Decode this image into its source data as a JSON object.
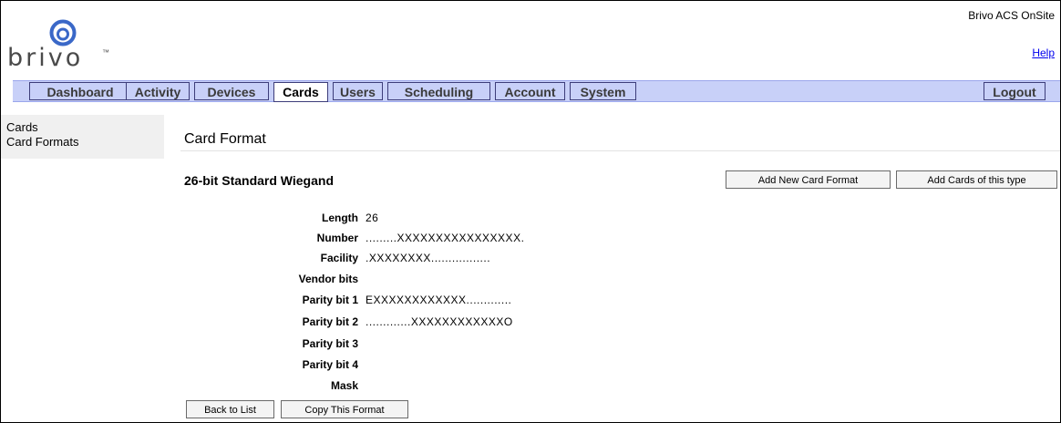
{
  "header": {
    "logo_text": "brivo",
    "logo_tm": "™",
    "app_title": "Brivo ACS OnSite",
    "help_link": "Help"
  },
  "nav": {
    "tabs": [
      {
        "label": "Dashboard"
      },
      {
        "label": "Activity"
      },
      {
        "label": "Devices"
      },
      {
        "label": "Cards",
        "active": true
      },
      {
        "label": "Users"
      },
      {
        "label": "Scheduling"
      },
      {
        "label": "Account"
      },
      {
        "label": "System"
      }
    ],
    "logout_label": "Logout"
  },
  "sidebar": {
    "items": [
      {
        "label": "Cards"
      },
      {
        "label": "Card Formats"
      }
    ]
  },
  "main": {
    "section_title": "Card Format",
    "format_name": "26-bit Standard Wiegand",
    "add_new_format_button": "Add New Card Format",
    "add_cards_button": "Add Cards of this type",
    "fields": [
      {
        "label": "Length",
        "value": "26"
      },
      {
        "label": "Number",
        "value": ".........XXXXXXXXXXXXXXXX."
      },
      {
        "label": "Facility",
        "value": ".XXXXXXXX................."
      },
      {
        "label": "Vendor bits",
        "value": ""
      },
      {
        "label": "Parity bit 1",
        "value": "EXXXXXXXXXXXX............."
      },
      {
        "label": "Parity bit 2",
        "value": ".............XXXXXXXXXXXXO"
      },
      {
        "label": "Parity bit 3",
        "value": ""
      },
      {
        "label": "Parity bit 4",
        "value": ""
      },
      {
        "label": "Mask",
        "value": ""
      }
    ],
    "back_button": "Back to List",
    "copy_button": "Copy This Format"
  },
  "colors": {
    "nav_background": "#c8d0f8",
    "tab_border": "#3d3d7a",
    "logo_blue": "#3a68c8",
    "link": "#0000ee",
    "sidebar_background": "#f0f0f0"
  }
}
